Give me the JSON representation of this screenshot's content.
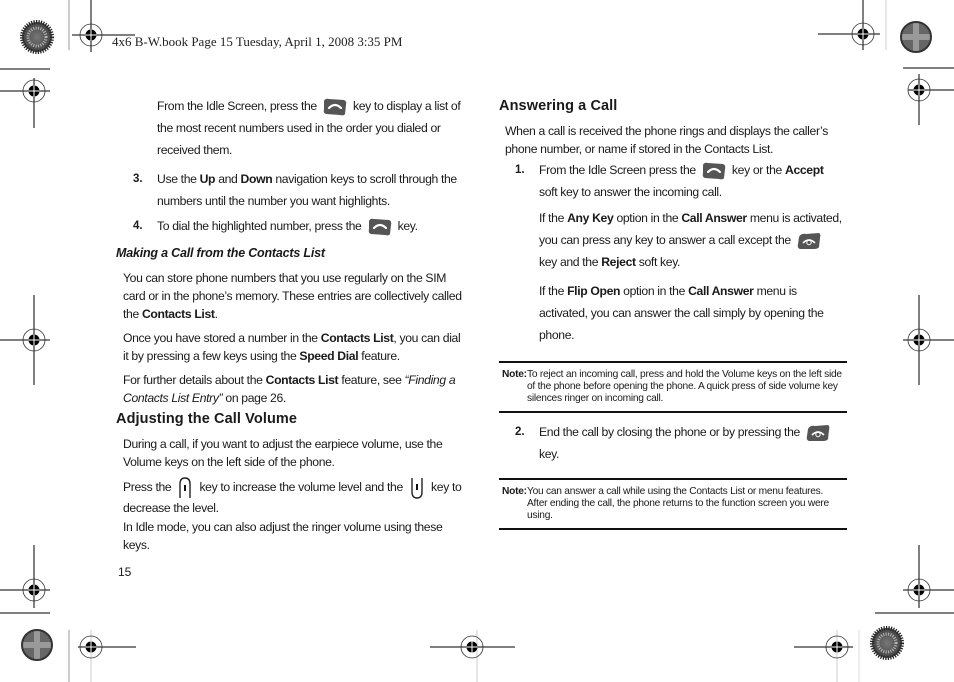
{
  "header": {
    "text": "4x6 B-W.book  Page 15  Tuesday, April 1, 2008  3:35 PM"
  },
  "left_column": {
    "intro_para": {
      "pre": "From the Idle Screen, press the",
      "icon": "send-key-icon",
      "post": "key to display a list of the most recent numbers used in the order you dialed or received them."
    },
    "step3": {
      "number": "3.",
      "pre": "Use the",
      "bold1": "Up",
      "mid": "and",
      "bold2": "Down",
      "post": "navigation keys to scroll through the numbers until the number you want highlights."
    },
    "step4": {
      "number": "4.",
      "pre": "To dial the highlighted number, press the",
      "icon": "send-key-icon",
      "post": "key."
    },
    "contacts_heading": "Making a Call from the Contacts List",
    "contacts_para1": {
      "pre": "You can store phone numbers that you use regularly on the SIM card or in the phone’s memory. These entries are collectively called the",
      "bold": "Contacts List",
      "post": "."
    },
    "contacts_para2": {
      "pre": "Once you have stored a number in the",
      "bold1": "Contacts List",
      "mid": ", you can dial it by pressing a few keys using the",
      "bold2": "Speed Dial",
      "post": "feature."
    },
    "contacts_para3": {
      "pre": "For further details about the",
      "bold": "Contacts List",
      "mid": "feature, see",
      "italic": "“Finding a Contacts List Entry”",
      "post": "on page 26."
    },
    "volume_heading": "Adjusting the Call Volume",
    "volume_para1": "During a call, if you want to adjust the earpiece volume, use the Volume keys on the left side of the phone.",
    "volume_para2": {
      "pre": "Press the",
      "icon_up": "volume-up-key-icon",
      "mid": "key to increase the volume level and the",
      "icon_down": "volume-down-key-icon",
      "post": "key to decrease the level."
    },
    "volume_para3": "In Idle mode, you can also adjust the ringer volume using these keys.",
    "page_number": "15"
  },
  "right_column": {
    "answer_heading": "Answering a Call",
    "answer_intro": "When a call is received the phone rings and displays the caller’s phone number, or name if stored in the Contacts List.",
    "step1": {
      "number": "1.",
      "pre": "From the Idle Screen press the",
      "icon": "send-key-icon",
      "mid": "key or the",
      "bold": "Accept",
      "post": "soft key to answer the incoming call."
    },
    "anykey_para": {
      "pre": "If the",
      "bold1": "Any Key",
      "mid1": "option in the",
      "bold2": "Call Answer",
      "mid2": "menu is activated, you can press any key to answer a call except the",
      "icon": "end-key-icon",
      "mid3": "key and the",
      "bold3": "Reject",
      "post": "soft key."
    },
    "flipopen_para": {
      "pre": "If the",
      "bold1": "Flip Open",
      "mid1": "option in the",
      "bold2": "Call Answer",
      "post": "menu is activated, you can answer the call simply by opening the phone."
    },
    "note1": {
      "label": "Note:",
      "text": "To reject an incoming call, press and hold the Volume keys on the left side of the phone before opening the phone. A quick press of side volume key silences ringer on incoming call."
    },
    "step2": {
      "number": "2.",
      "pre": "End the call by closing the phone or by pressing the",
      "icon": "end-key-icon",
      "post": "key."
    },
    "note2": {
      "label": "Note:",
      "text": "You can answer a call while using the Contacts List or menu features. After ending the call, the phone returns to the function screen you were using."
    }
  },
  "colors": {
    "text": "#1a1a1a",
    "key_icon": "#555555",
    "rule": "#111111"
  }
}
